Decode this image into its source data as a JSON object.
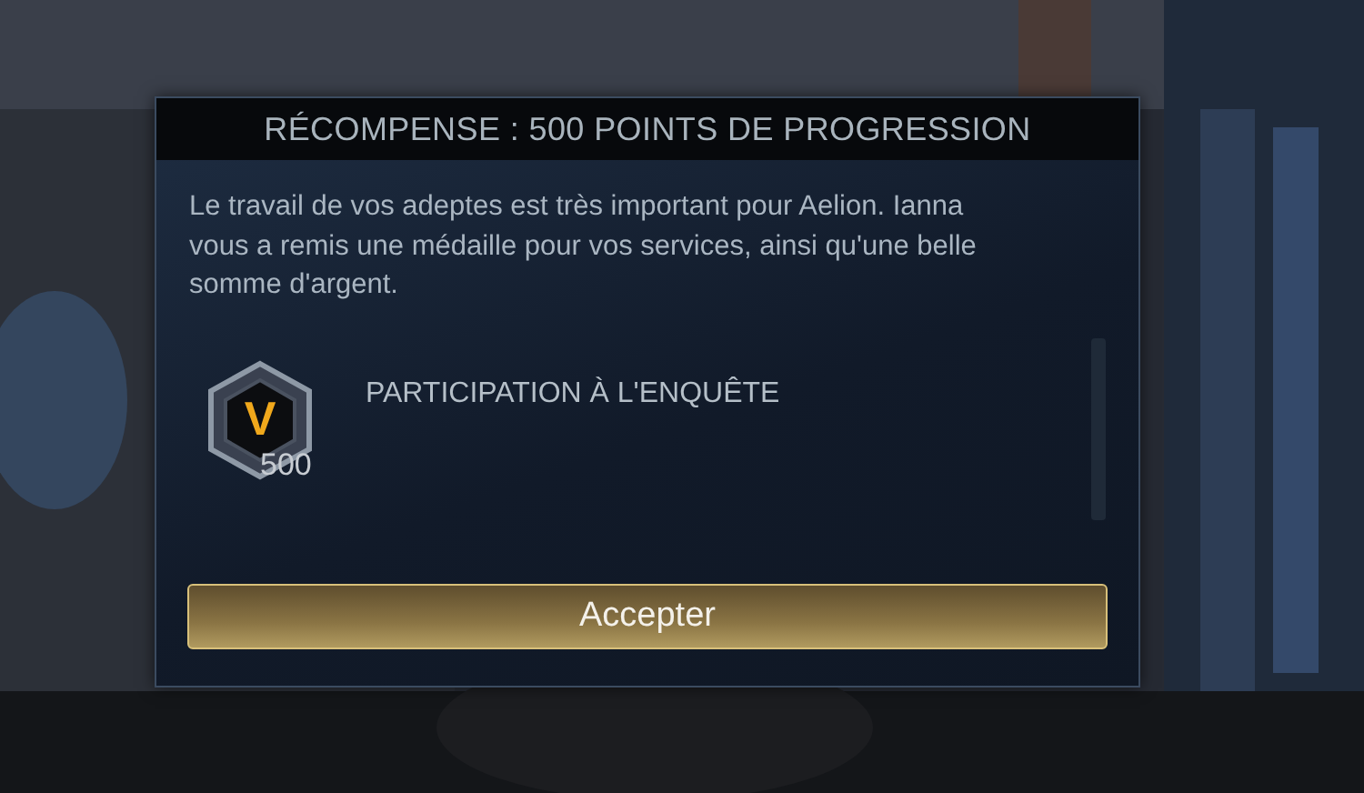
{
  "dialog": {
    "title": "RÉCOMPENSE : 500 POINTS DE PROGRESSION",
    "message": "Le travail de vos adeptes est très important pour Aelion. Ianna vous a remis une médaille pour vos services, ainsi qu'une belle somme d'argent.",
    "rewards": [
      {
        "medal_letter": "V",
        "amount": "500",
        "label": "PARTICIPATION À L'ENQUÊTE"
      }
    ],
    "button": "Accepter"
  }
}
